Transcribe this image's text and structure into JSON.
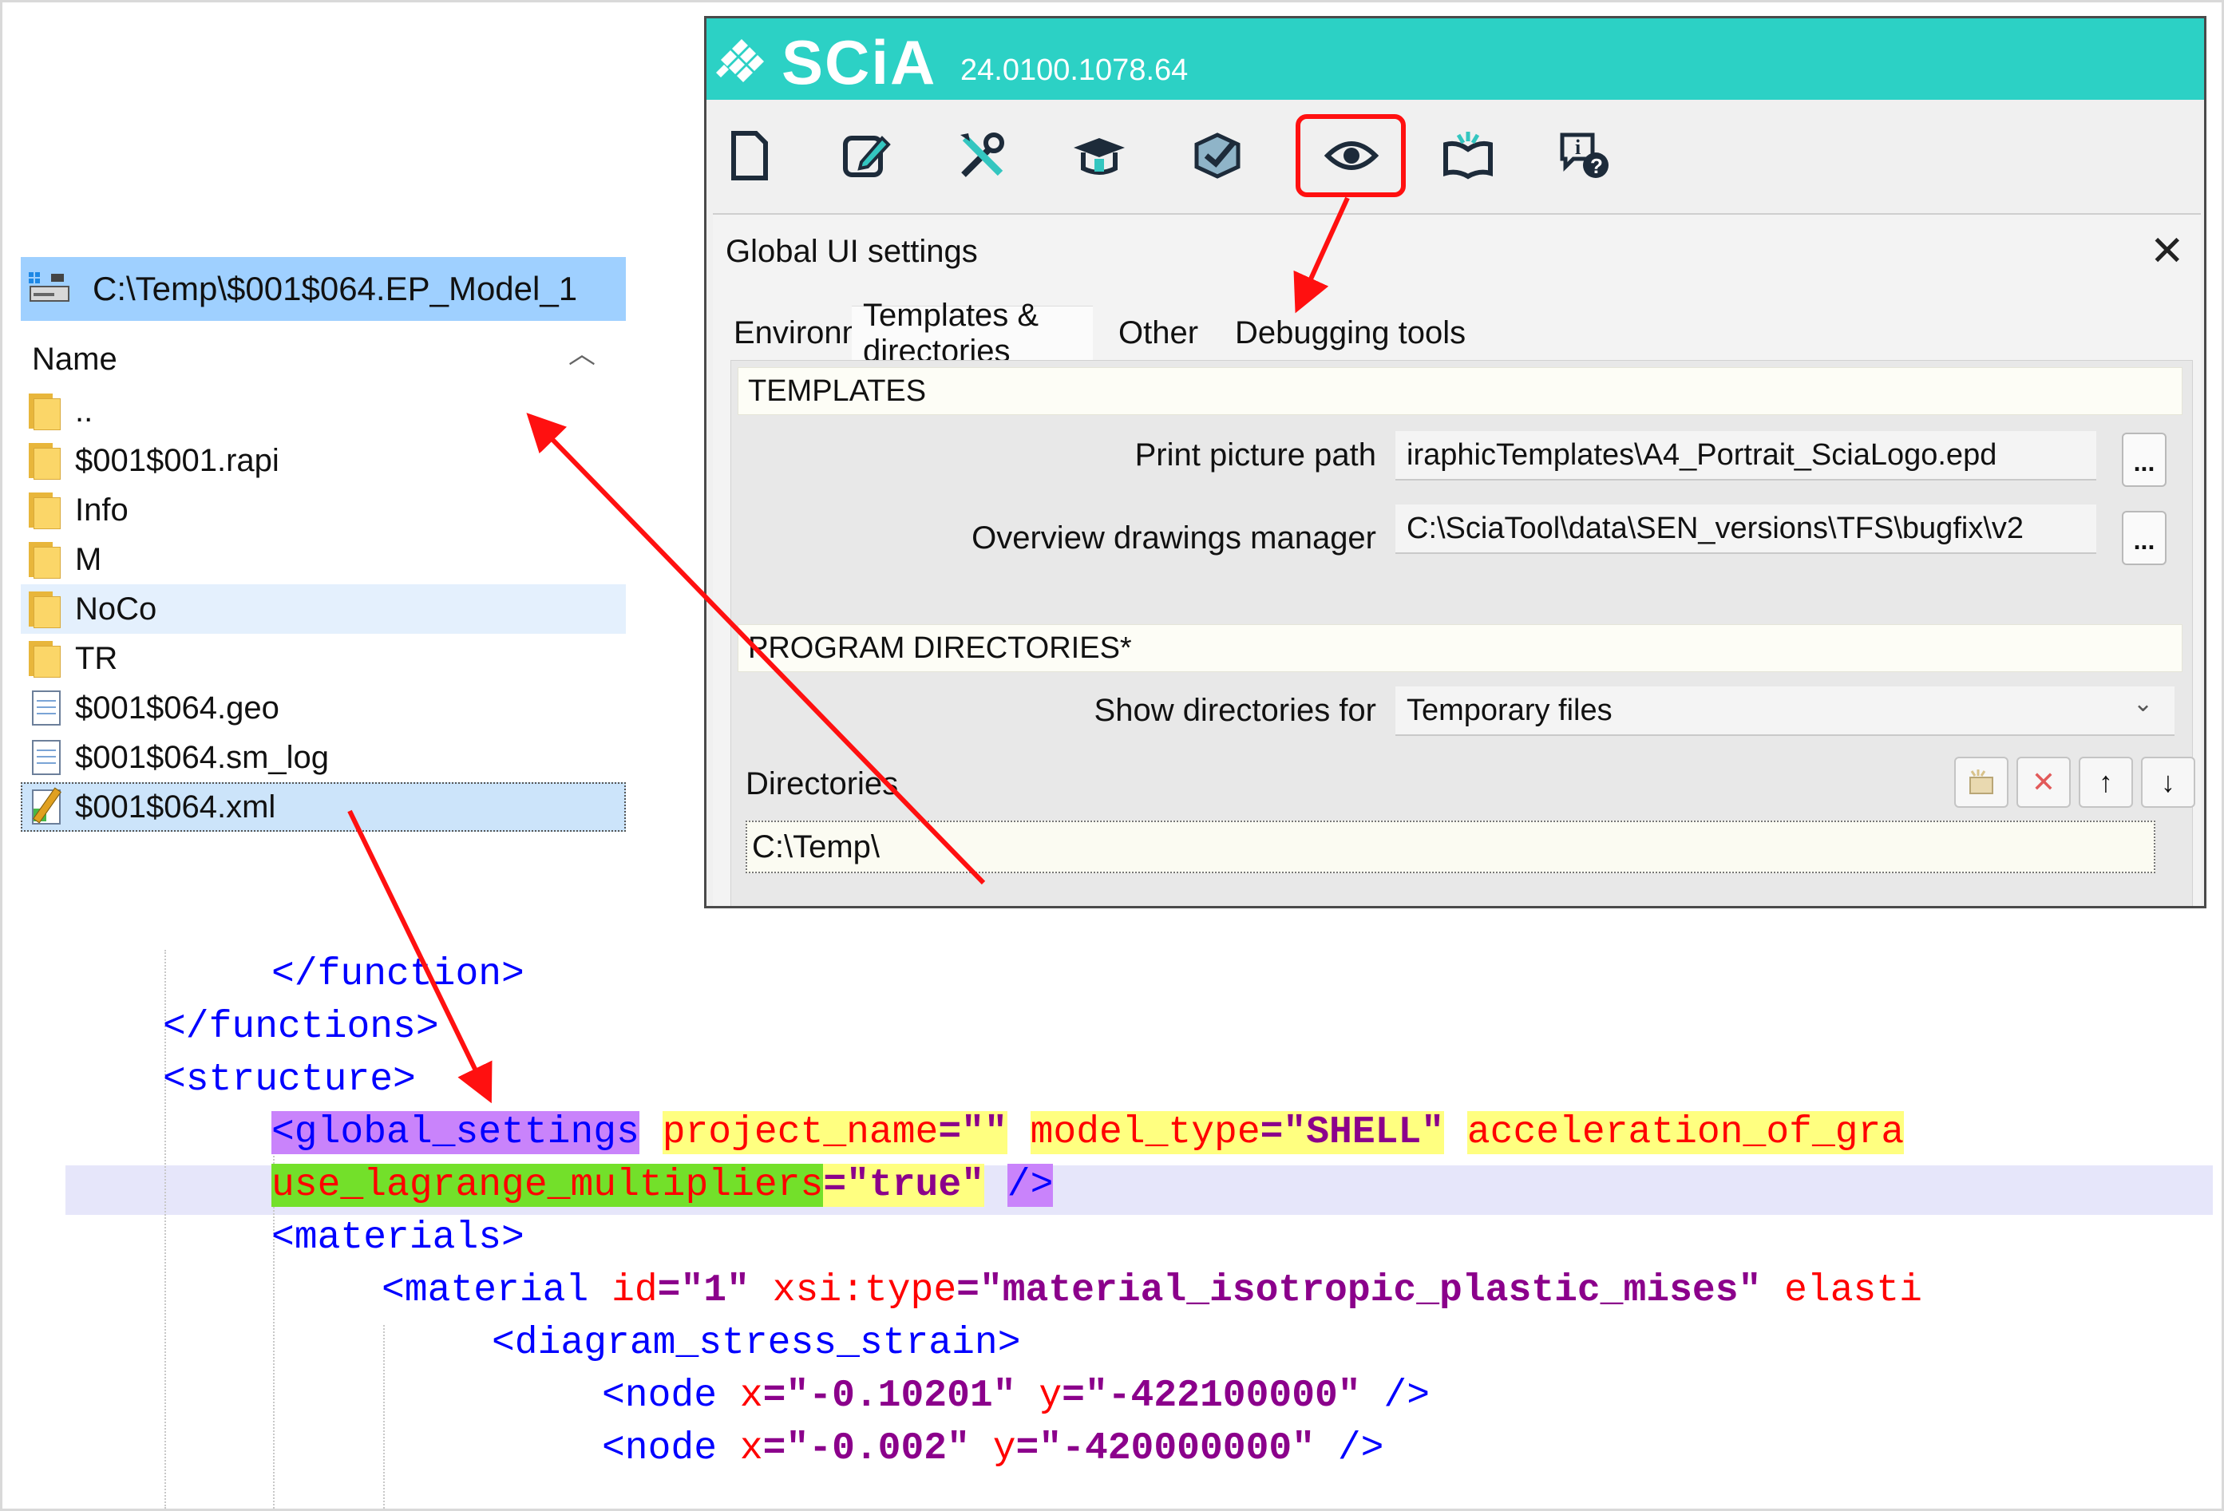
{
  "explorer": {
    "path": "C:\\Temp\\$001$064.EP_Model_1",
    "column_header": "Name",
    "items": [
      {
        "name": "..",
        "type": "folder"
      },
      {
        "name": "$001$001.rapi",
        "type": "folder"
      },
      {
        "name": "Info",
        "type": "folder"
      },
      {
        "name": "M",
        "type": "folder"
      },
      {
        "name": "NoCo",
        "type": "folder"
      },
      {
        "name": "TR",
        "type": "folder"
      },
      {
        "name": "$001$064.geo",
        "type": "file"
      },
      {
        "name": "$001$064.sm_log",
        "type": "file"
      },
      {
        "name": "$001$064.xml",
        "type": "xml"
      }
    ]
  },
  "scia": {
    "app_name": "SCiA",
    "version": "24.0100.1078.64",
    "accent_color": "#2cd1c5",
    "toolbar": [
      {
        "icon": "new-document-icon"
      },
      {
        "icon": "edit-icon"
      },
      {
        "icon": "tools-icon"
      },
      {
        "icon": "graduation-icon"
      },
      {
        "icon": "check-box-icon"
      },
      {
        "icon": "eye-icon"
      },
      {
        "icon": "open-book-icon"
      },
      {
        "icon": "info-help-icon"
      }
    ],
    "dialog": {
      "title": "Global UI settings",
      "close": "✕",
      "tabs": [
        "Environment",
        "Templates & directories",
        "Other",
        "Debugging tools"
      ],
      "active_tab": "Templates & directories",
      "templates_section": "TEMPLATES",
      "print_picture_label": "Print picture path",
      "print_picture_value": "iraphicTemplates\\A4_Portrait_SciaLogo.epd",
      "overview_label": "Overview drawings manager",
      "overview_value": "C:\\SciaTool\\data\\SEN_versions\\TFS\\bugfix\\v2",
      "browse": "...",
      "program_dirs_section": "PROGRAM DIRECTORIES*",
      "show_dirs_label": "Show directories for",
      "show_dirs_value": "Temporary files",
      "caret": "⌄",
      "directories_label": "Directories",
      "directory_value": "C:\\Temp\\"
    }
  },
  "xml": {
    "l1": "</function>",
    "l2": "</functions>",
    "l3": "<structure>",
    "l4_tag": "<global_settings",
    "l4_a1": "project_name",
    "l4_v1": "=\"\"",
    "l4_a2": "model_type",
    "l4_v2": "=\"SHELL\"",
    "l4_a3": "acceleration_of_gra",
    "l5_attr": "use_lagrange_multipliers",
    "l5_val": "=\"true\"",
    "l5_close": "/>",
    "l6": "<materials>",
    "l7_tag": "<material",
    "l7_a1": "id",
    "l7_v1": "=\"1\"",
    "l7_a2": "xsi:type",
    "l7_v2": "=\"material_isotropic_plastic_mises\"",
    "l7_a3": "elasti",
    "l8": "<diagram_stress_strain>",
    "l9_tag": "<node",
    "l9_ax": "x",
    "l9_vx": "=\"-0.10201\"",
    "l9_ay": "y",
    "l9_vy": "=\"-422100000\"",
    "l9_close": "/>",
    "l10_tag": "<node",
    "l10_ax": "x",
    "l10_vx": "=\"-0.002\"",
    "l10_ay": "y",
    "l10_vy": "=\"-420000000\"",
    "l10_close": "/>"
  },
  "annotation_color": "#ff1010"
}
